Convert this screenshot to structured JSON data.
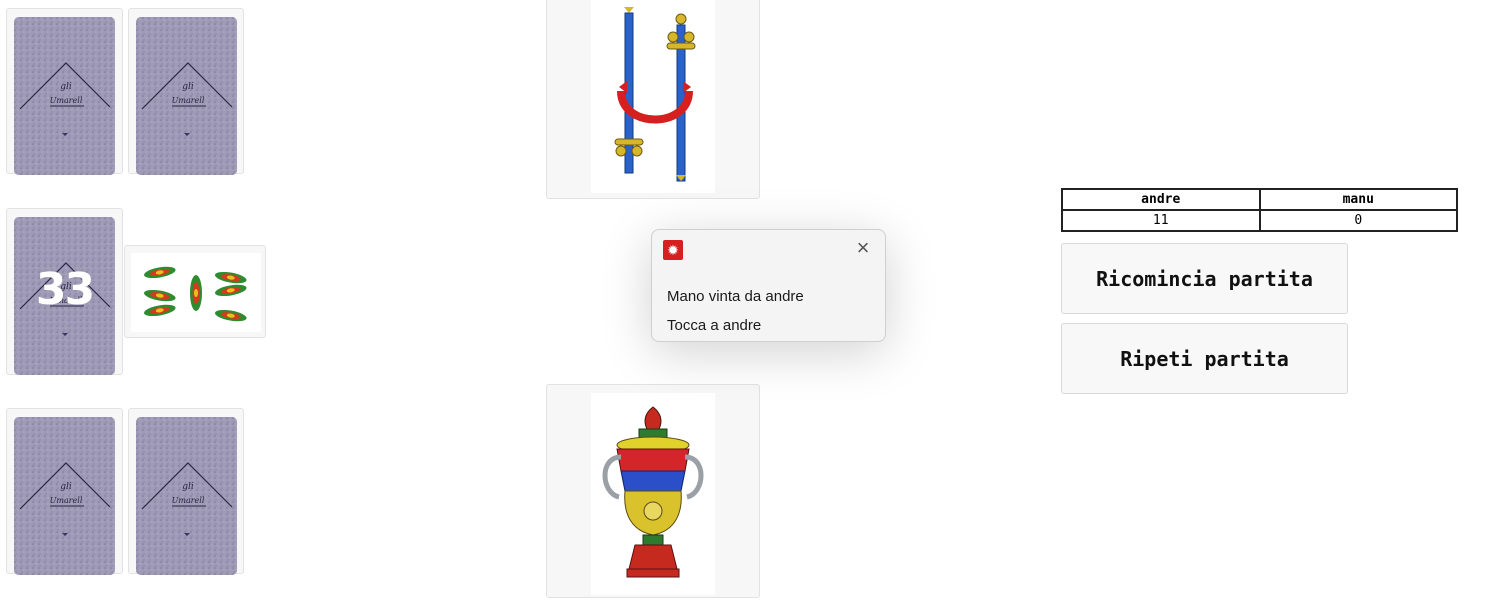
{
  "opponent_hand": {
    "cards": [
      {
        "face": "back"
      },
      {
        "face": "back"
      }
    ]
  },
  "deck": {
    "remaining_count": "33",
    "trump_card": {
      "suit": "bastoni",
      "rank": "7"
    }
  },
  "player_hand": {
    "cards": [
      {
        "face": "back"
      },
      {
        "face": "back"
      }
    ]
  },
  "table": {
    "top_card": {
      "suit": "spade",
      "rank": "2"
    },
    "bottom_card": {
      "suit": "coppe",
      "rank": "asso"
    }
  },
  "scoreboard": {
    "players": [
      "andre",
      "manu"
    ],
    "scores": [
      "11",
      "0"
    ]
  },
  "buttons": {
    "restart_label": "Ricomincia partita",
    "repeat_label": "Ripeti partita"
  },
  "notification": {
    "app_icon": "gear-badge-icon",
    "message_line1": "Mano vinta da andre",
    "message_line2": "Tocca a andre"
  },
  "colors": {
    "card_back": "#9d98b4",
    "notification_icon": "#d62020"
  }
}
